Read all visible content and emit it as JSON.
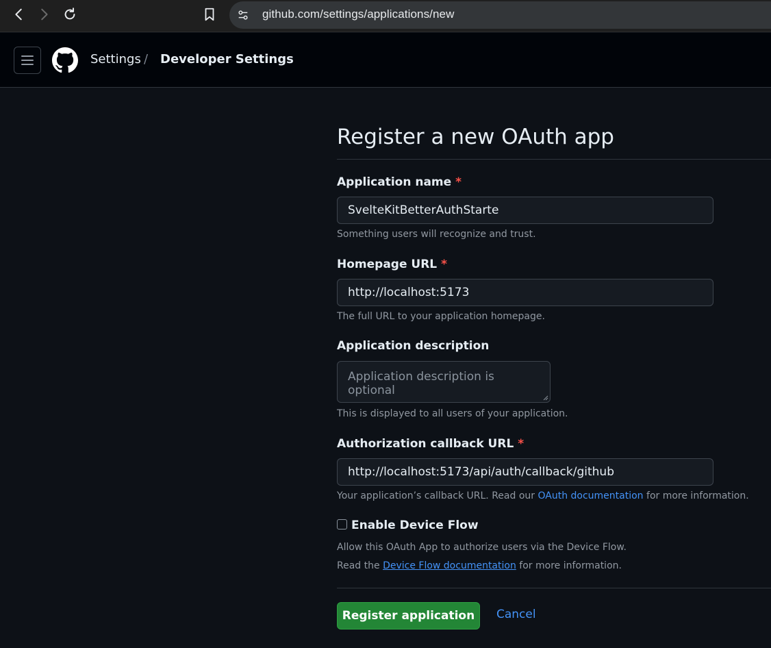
{
  "browser": {
    "url": "github.com/settings/applications/new"
  },
  "header": {
    "breadcrumb_settings": "Settings",
    "breadcrumb_separator": "/",
    "breadcrumb_current": "Developer Settings"
  },
  "form": {
    "title": "Register a new OAuth app",
    "app_name": {
      "label": "Application name",
      "required_mark": "*",
      "value": "SvelteKitBetterAuthStarte",
      "hint": "Something users will recognize and trust."
    },
    "homepage": {
      "label": "Homepage URL",
      "required_mark": "*",
      "value": "http://localhost:5173",
      "hint": "The full URL to your application homepage."
    },
    "description": {
      "label": "Application description",
      "placeholder": "Application description is optional",
      "hint": "This is displayed to all users of your application."
    },
    "callback": {
      "label": "Authorization callback URL",
      "required_mark": "*",
      "value": "http://localhost:5173/api/auth/callback/github",
      "hint_prefix": "Your application’s callback URL. Read our ",
      "hint_link": "OAuth documentation",
      "hint_suffix": " for more information."
    },
    "device_flow": {
      "label": "Enable Device Flow",
      "checked": false,
      "hint_line1": "Allow this OAuth App to authorize users via the Device Flow.",
      "hint_line2_prefix": "Read the ",
      "hint_line2_link": "Device Flow documentation",
      "hint_line2_suffix": " for more information."
    },
    "register_button": "Register application",
    "cancel_link": "Cancel"
  },
  "icons": {
    "back": "chevron-left-icon",
    "forward": "chevron-right-icon",
    "reload": "reload-icon",
    "bookmark": "bookmark-icon",
    "site_info": "tune-icon",
    "menu": "hamburger-icon",
    "logo": "github-logo-icon"
  },
  "colors": {
    "required": "#f85149",
    "link": "#4493f8",
    "primary_button": "#238636",
    "background": "#0d1117"
  }
}
